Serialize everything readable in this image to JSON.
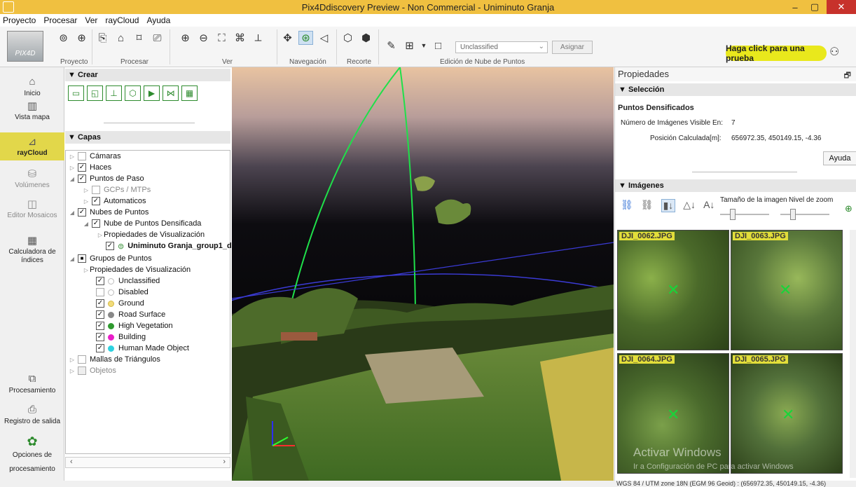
{
  "window": {
    "title": "Pix4Ddiscovery Preview - Non Commercial - Uniminuto Granja",
    "min": "–",
    "max": "▢",
    "close": "✕"
  },
  "menu": [
    "Proyecto",
    "Procesar",
    "Ver",
    "rayCloud",
    "Ayuda"
  ],
  "ribbon": {
    "logo": "PIX4D",
    "groups": [
      "Proyecto",
      "Procesar",
      "Ver",
      "Navegación",
      "Recorte",
      "Edición de Nube de Puntos"
    ],
    "class_select": "Unclassified",
    "assign": "Asignar",
    "try_button": "Haga click para una prueba"
  },
  "nav": [
    {
      "label": "Inicio",
      "icon": "⌂"
    },
    {
      "label": "Vista mapa",
      "icon": "▥"
    },
    {
      "label": "rayCloud",
      "icon": "⊿"
    },
    {
      "label": "Volúmenes",
      "icon": "⛁"
    },
    {
      "label": "Editor Mosaicos",
      "icon": "◫"
    },
    {
      "label": "Calculadora de índices",
      "icon": "▦"
    },
    {
      "label": "Procesamiento",
      "icon": "⧉"
    },
    {
      "label": "Registro de salida",
      "icon": "⎙"
    },
    {
      "label": "Opciones de procesamiento",
      "icon": "✿"
    }
  ],
  "crear": {
    "title": "Crear"
  },
  "capas": {
    "title": "Capas",
    "items": [
      {
        "label": "Cámaras",
        "check": "off"
      },
      {
        "label": "Haces",
        "check": "on"
      },
      {
        "label": "Puntos de Paso",
        "check": "on"
      },
      {
        "label": "GCPs / MTPs",
        "check": "off"
      },
      {
        "label": "Automaticos",
        "check": "on"
      },
      {
        "label": "Nubes de Puntos",
        "check": "on"
      },
      {
        "label": "Nube de Puntos Densificada",
        "check": "on"
      },
      {
        "label": "Propiedades de Visualización"
      },
      {
        "label": "Uniminuto Granja_group1_d",
        "check": "on"
      },
      {
        "label": "Grupos de Puntos",
        "check": "partial"
      },
      {
        "label": "Propiedades de Visualización"
      },
      {
        "label": "Unclassified",
        "check": "on",
        "color": "#ffffff"
      },
      {
        "label": "Disabled",
        "check": "off",
        "color": "#ffffff"
      },
      {
        "label": "Ground",
        "check": "on",
        "color": "#f2dc7a"
      },
      {
        "label": "Road Surface",
        "check": "on",
        "color": "#888888"
      },
      {
        "label": "High Vegetation",
        "check": "on",
        "color": "#2e9a2e"
      },
      {
        "label": "Building",
        "check": "on",
        "color": "#e91ec8"
      },
      {
        "label": "Human Made Object",
        "check": "on",
        "color": "#2ed2e0"
      },
      {
        "label": "Mallas de Triángulos",
        "check": "off"
      },
      {
        "label": "Objetos",
        "check": "off"
      }
    ]
  },
  "props": {
    "title": "Propiedades",
    "seleccion": "Selección",
    "heading": "Puntos Densificados",
    "num_label": "Número de Imágenes Visible En:",
    "num_value": "7",
    "pos_label": "Posición Calculada[m]:",
    "pos_value": "656972.35, 450149.15, -4.36",
    "ayuda": "Ayuda",
    "imagenes": "Imágenes",
    "tamano": "Tamaño de la imagen",
    "zoom": "Nivel de zoom",
    "images": [
      "DJI_0062.JPG",
      "DJI_0063.JPG",
      "DJI_0064.JPG",
      "DJI_0065.JPG"
    ]
  },
  "watermark": {
    "line1": "Activar Windows",
    "line2": "Ir a Configuración de PC para activar Windows"
  },
  "status": "WGS 84 / UTM zone 18N (EGM 96 Geoid) : (656972.35, 450149.15, -4.36)"
}
